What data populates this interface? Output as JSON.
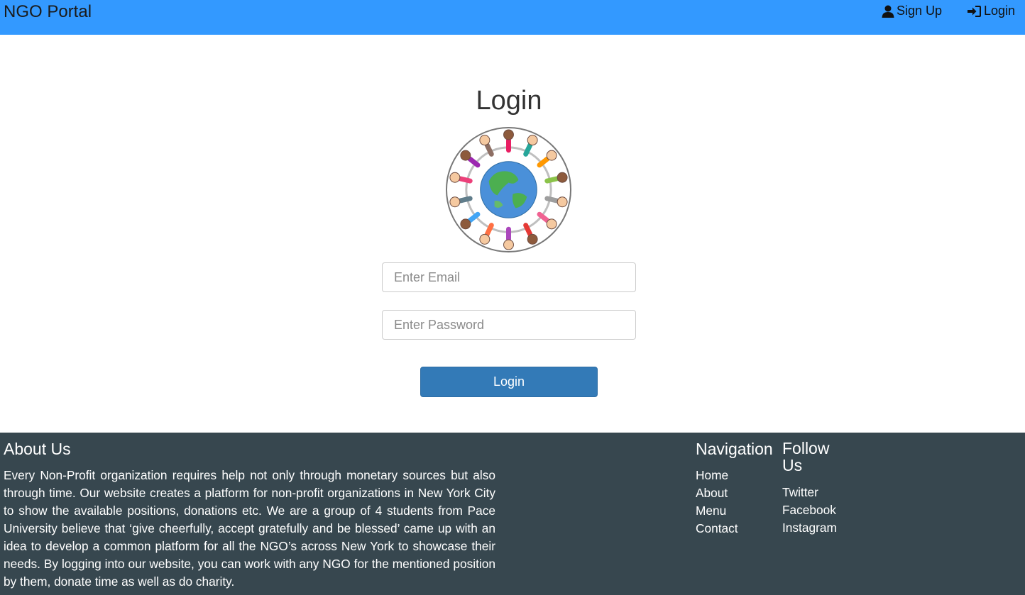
{
  "navbar": {
    "brand": "NGO Portal",
    "signup_label": "Sign Up",
    "login_label": "Login"
  },
  "login": {
    "title": "Login",
    "email_placeholder": "Enter Email",
    "password_placeholder": "Enter Password",
    "submit_label": "Login"
  },
  "footer": {
    "about_heading": "About Us",
    "about_text": "Every Non-Profit organization requires help not only through monetary sources but also through time. Our website creates a platform for non-profit organizations in New York City to show the available positions, donations etc. We are a group of 4 students from Pace University believe that ‘give cheerfully, accept gratefully and be blessed’ came up with an idea to develop a common platform for all the NGO’s across New York to showcase their needs. By logging into our website, you can work with any NGO for the mentioned position by them, donate time as well as do charity.",
    "navigation_heading": "Navigation",
    "navigation_items": [
      "Home",
      "About",
      "Menu",
      "Contact"
    ],
    "follow_heading": "Follow Us",
    "follow_items": [
      "Twitter",
      "Facebook",
      "Instagram"
    ]
  },
  "colors": {
    "navbar": "#3399ff",
    "button": "#337ab7",
    "footer": "#37474f"
  },
  "icons": {
    "signup": "user-icon",
    "login": "sign-in-icon"
  }
}
